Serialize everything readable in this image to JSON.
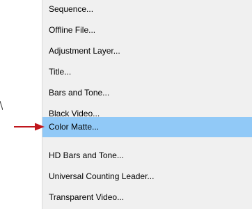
{
  "context_menu": {
    "items": [
      {
        "label": "Sequence..."
      },
      {
        "label": "Offline File..."
      },
      {
        "label": "Adjustment Layer..."
      },
      {
        "label": "Title..."
      },
      {
        "label": "Bars and Tone..."
      },
      {
        "label": "Black Video..."
      },
      {
        "label": "Color Matte...",
        "highlighted": true
      },
      {
        "label": "HD Bars and Tone..."
      },
      {
        "label": "Universal Counting Leader..."
      },
      {
        "label": "Transparent Video..."
      }
    ],
    "highlight_color": "#91c9f7"
  },
  "annotation": {
    "arrow_icon": "red-arrow-icon",
    "arrow_color": "#c0161c",
    "points_to": "Color Matte..."
  }
}
